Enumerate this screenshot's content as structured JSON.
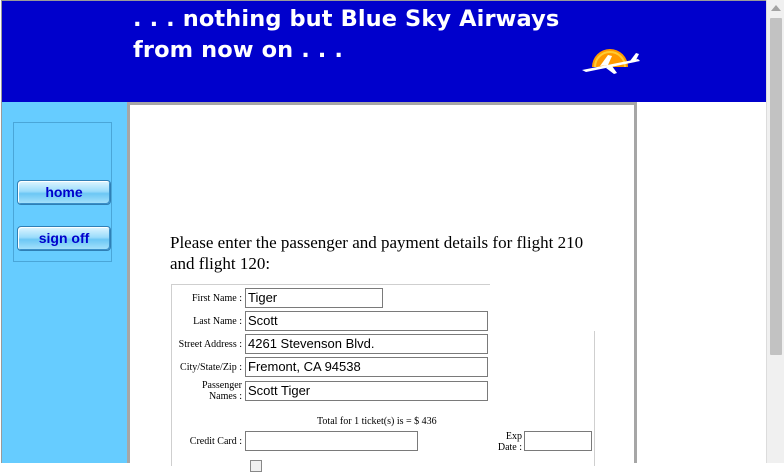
{
  "banner": {
    "line1": ". . . nothing but Blue Sky Airways",
    "line2": "from now on . . ."
  },
  "nav": {
    "home_label": "home",
    "signoff_label": "sign off"
  },
  "main": {
    "intro": "Please enter the passenger and payment details for flight 210 and flight 120:"
  },
  "form": {
    "first_name_label": "First Name :",
    "first_name_value": "Tiger",
    "last_name_label": "Last Name :",
    "last_name_value": "Scott",
    "street_label": "Street Address :",
    "street_value": "4261 Stevenson Blvd.",
    "city_label": "City/State/Zip :",
    "city_value": "Fremont, CA 94538",
    "passenger_label_1": "Passenger",
    "passenger_label_2": "Names :",
    "passenger_value": "Scott Tiger",
    "total_text": "Total for 1 ticket(s) is = $ 436",
    "credit_card_label": "Credit Card :",
    "credit_card_value": "",
    "exp_label_1": "Exp",
    "exp_label_2": "Date :",
    "exp_value": ""
  },
  "colors": {
    "banner": "#0000cc",
    "sidebar": "#66ccff",
    "button_text": "#0000cc"
  },
  "icons": {
    "logo": "airplane-sun-logo"
  }
}
